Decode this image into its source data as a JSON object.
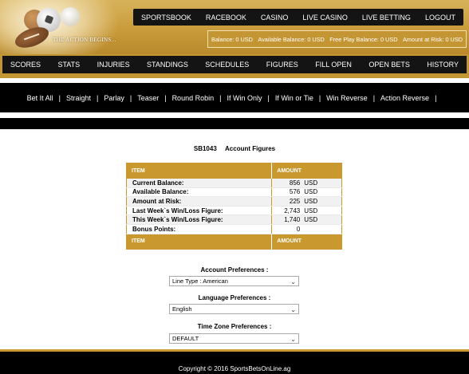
{
  "logo": {
    "tagline": "THE ACTION BEGINS...",
    "icon": "sports-balls-logo"
  },
  "topnav": [
    "SPORTSBOOK",
    "RACEBOOK",
    "CASINO",
    "LIVE CASINO",
    "LIVE BETTING",
    "LOGOUT"
  ],
  "balance": {
    "balance": "Balance: 0 USD",
    "available": "Available Balance: 0 USD",
    "free_play": "Free Play Balance: 0 USD",
    "at_risk": "Amount at Risk: 0 USD"
  },
  "mainnav": [
    "SCORES",
    "STATS",
    "INJURIES",
    "STANDINGS",
    "SCHEDULES",
    "FIGURES",
    "FILL OPEN",
    "OPEN BETS",
    "HISTORY"
  ],
  "bet_types": [
    "Bet It All",
    "Straight",
    "Parlay",
    "Teaser",
    "Round Robin",
    "If Win Only",
    "If Win or Tie",
    "Win Reverse",
    "Action Reverse"
  ],
  "page": {
    "account_id": "SB1043",
    "title": "Account Figures"
  },
  "figures": {
    "header_item": "ITEM",
    "header_amount": "AMOUNT",
    "rows": [
      {
        "label": "Current Balance:",
        "value": "856",
        "unit": "USD"
      },
      {
        "label": "Available Balance:",
        "value": "576",
        "unit": "USD"
      },
      {
        "label": "Amount at Risk:",
        "value": "225",
        "unit": "USD"
      },
      {
        "label": "Last Week`s Win/Loss Figure:",
        "value": "2,743",
        "unit": "USD"
      },
      {
        "label": "This Week`s Win/Loss Figure:",
        "value": "1,740",
        "unit": "USD"
      },
      {
        "label": "Bonus Points:",
        "value": "0",
        "unit": ""
      }
    ]
  },
  "preferences": {
    "account_label": "Account Preferences :",
    "account_value": "Line Type : American",
    "language_label": "Language Preferences :",
    "language_value": "English",
    "timezone_label": "Time Zone Preferences :",
    "timezone_value": "DEFAULT"
  },
  "footer": {
    "copyright": "Copyright © 2016 SportsBetsOnLine.ag"
  },
  "colors": {
    "gold": "#c9992f",
    "black": "#141414"
  }
}
